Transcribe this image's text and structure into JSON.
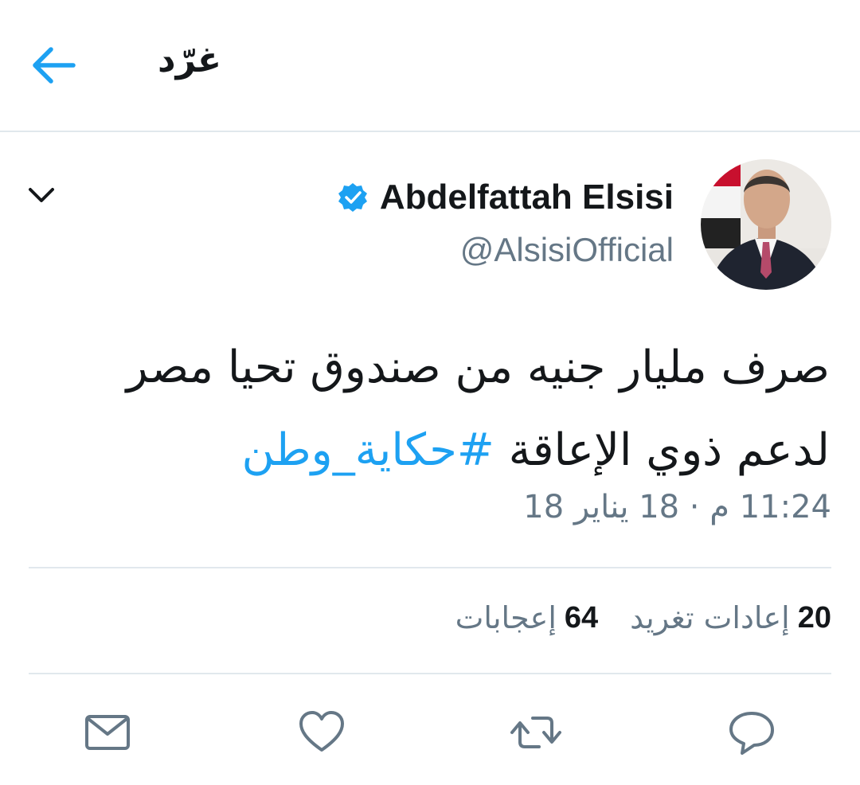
{
  "header": {
    "title": "غرّد",
    "back_icon": "arrow-left-icon"
  },
  "tweet": {
    "author": {
      "display_name": "Abdelfattah Elsisi",
      "handle": "@AlsisiOfficial",
      "verified_icon": "verified-badge-icon"
    },
    "text": "صرف مليار جنيه من صندوق تحيا مصر لدعم ذوي الإعاقة",
    "hashtag": "#حكاية_وطن",
    "timestamp": "11:24 م · 18 يناير 18",
    "stats": {
      "retweets_count": "20",
      "retweets_label": "إعادات تغريد",
      "likes_count": "64",
      "likes_label": "إعجابات"
    },
    "actions": [
      "reply-icon",
      "retweet-icon",
      "like-icon",
      "share-dm-icon"
    ]
  },
  "colors": {
    "accent": "#1da1f2",
    "text_primary": "#14171a",
    "text_secondary": "#657786",
    "divider": "#e1e8ed"
  }
}
